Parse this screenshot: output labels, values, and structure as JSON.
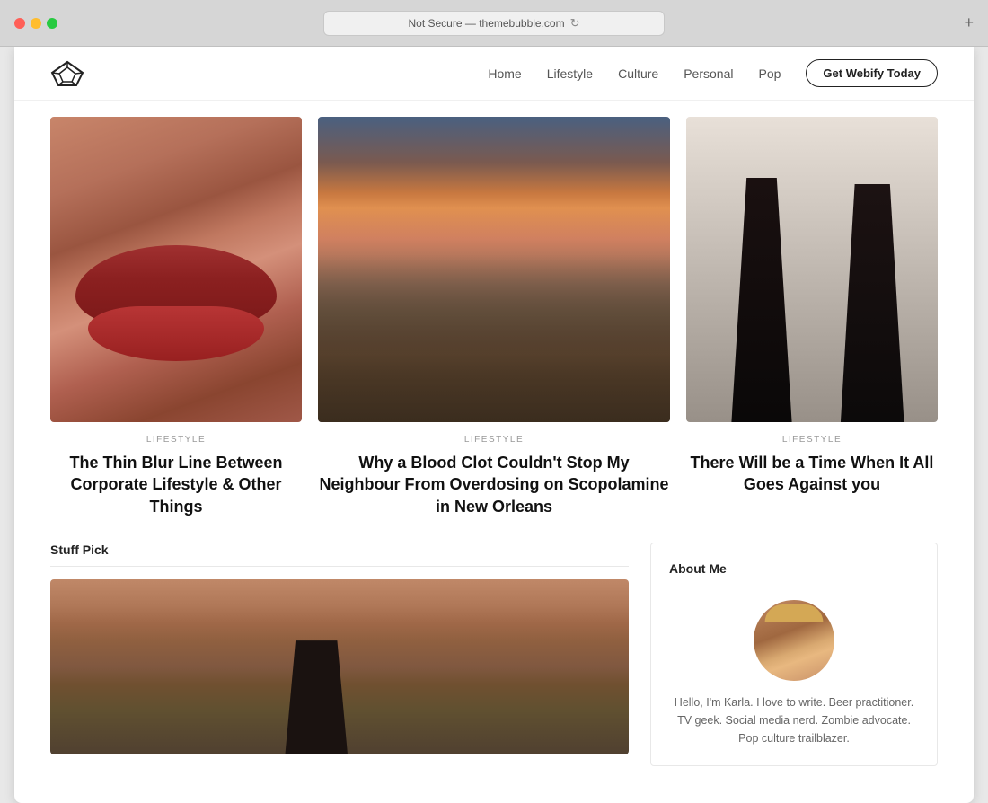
{
  "browser": {
    "address": "Not Secure — themebubble.com",
    "new_tab_label": "+"
  },
  "nav": {
    "links": [
      {
        "label": "Home"
      },
      {
        "label": "Lifestyle"
      },
      {
        "label": "Culture"
      },
      {
        "label": "Personal"
      },
      {
        "label": "Pop"
      }
    ],
    "cta_label": "Get Webify Today"
  },
  "featured": [
    {
      "category": "LIFESTYLE",
      "title": "The Thin Blur Line Between Corporate Lifestyle & Other Things"
    },
    {
      "category": "LIFESTYLE",
      "title": "Why a Blood Clot Couldn't Stop My Neighbour From Overdosing on Scopolamine in New Orleans"
    },
    {
      "category": "LIFESTYLE",
      "title": "There Will be a Time When It All Goes Against you"
    }
  ],
  "stuff_pick": {
    "label": "Stuff Pick"
  },
  "about_me": {
    "title": "About Me",
    "text": "Hello, I'm Karla. I love to write. Beer practitioner. TV geek. Social media nerd. Zombie advocate. Pop culture trailblazer."
  }
}
